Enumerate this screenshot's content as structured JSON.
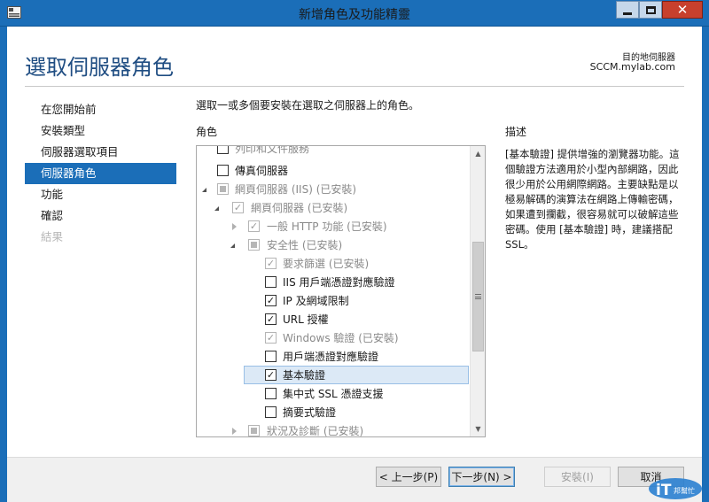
{
  "window": {
    "title": "新增角色及功能精靈",
    "minimize_icon": "minimize-icon",
    "maximize_icon": "maximize-icon",
    "close_icon": "close-icon"
  },
  "header": {
    "page_title": "選取伺服器角色",
    "destination_label": "目的地伺服器",
    "destination_server": "SCCM.mylab.com"
  },
  "nav": {
    "items": [
      {
        "label": "在您開始前",
        "state": "normal"
      },
      {
        "label": "安裝類型",
        "state": "normal"
      },
      {
        "label": "伺服器選取項目",
        "state": "normal"
      },
      {
        "label": "伺服器角色",
        "state": "active"
      },
      {
        "label": "功能",
        "state": "normal"
      },
      {
        "label": "確認",
        "state": "normal"
      },
      {
        "label": "結果",
        "state": "disabled"
      }
    ]
  },
  "main": {
    "instruction": "選取一或多個要安裝在選取之伺服器上的角色。",
    "roles_header": "角色",
    "description_header": "描述",
    "description_text": "[基本驗證] 提供增強的瀏覽器功能。這個驗證方法適用於小型內部網路，因此很少用於公用網際網路。主要缺點是以極易解碼的演算法在網路上傳輸密碼，如果遭到攔截，很容易就可以破解這些密碼。使用 [基本驗證] 時，建議搭配 SSL。",
    "tree": [
      {
        "label": "列印和文件服務",
        "check": "none",
        "disabled": false,
        "expander": ""
      },
      {
        "label": "傳真伺服器",
        "check": "none",
        "disabled": false,
        "expander": ""
      },
      {
        "label": "網頁伺服器 (IIS) (已安裝)",
        "check": "partial",
        "disabled": true,
        "expander": "expanded"
      },
      {
        "label": "網頁伺服器 (已安裝)",
        "check": "checked",
        "disabled": true,
        "expander": "expanded"
      },
      {
        "label": "一般 HTTP 功能 (已安裝)",
        "check": "checked",
        "disabled": true,
        "expander": "collapsed"
      },
      {
        "label": "安全性 (已安裝)",
        "check": "partial",
        "disabled": true,
        "expander": "expanded"
      },
      {
        "label": "要求篩選 (已安裝)",
        "check": "checked",
        "disabled": true,
        "expander": ""
      },
      {
        "label": "IIS 用戶端憑證對應驗證",
        "check": "none",
        "disabled": false,
        "expander": ""
      },
      {
        "label": "IP 及網域限制",
        "check": "checked",
        "disabled": false,
        "expander": ""
      },
      {
        "label": "URL 授權",
        "check": "checked",
        "disabled": false,
        "expander": ""
      },
      {
        "label": "Windows 驗證 (已安裝)",
        "check": "checked",
        "disabled": true,
        "expander": ""
      },
      {
        "label": "用戶端憑證對應驗證",
        "check": "none",
        "disabled": false,
        "expander": ""
      },
      {
        "label": "基本驗證",
        "check": "checked",
        "disabled": false,
        "expander": "",
        "selected": true
      },
      {
        "label": "集中式 SSL 憑證支援",
        "check": "none",
        "disabled": false,
        "expander": ""
      },
      {
        "label": "摘要式驗證",
        "check": "none",
        "disabled": false,
        "expander": ""
      },
      {
        "label": "狀況及診斷 (已安裝)",
        "check": "partial",
        "disabled": true,
        "expander": "collapsed"
      }
    ]
  },
  "footer": {
    "prev_label": "< 上一步(P)",
    "next_label": "下一步(N) >",
    "install_label": "安裝(I)",
    "cancel_label": "取消"
  },
  "watermark": {
    "text_main": "iT",
    "text_sub": "邦幫忙"
  },
  "colors": {
    "accent": "#1b6eb8",
    "title_text": "#1f4d82",
    "selected_row": "#dce9f6"
  }
}
